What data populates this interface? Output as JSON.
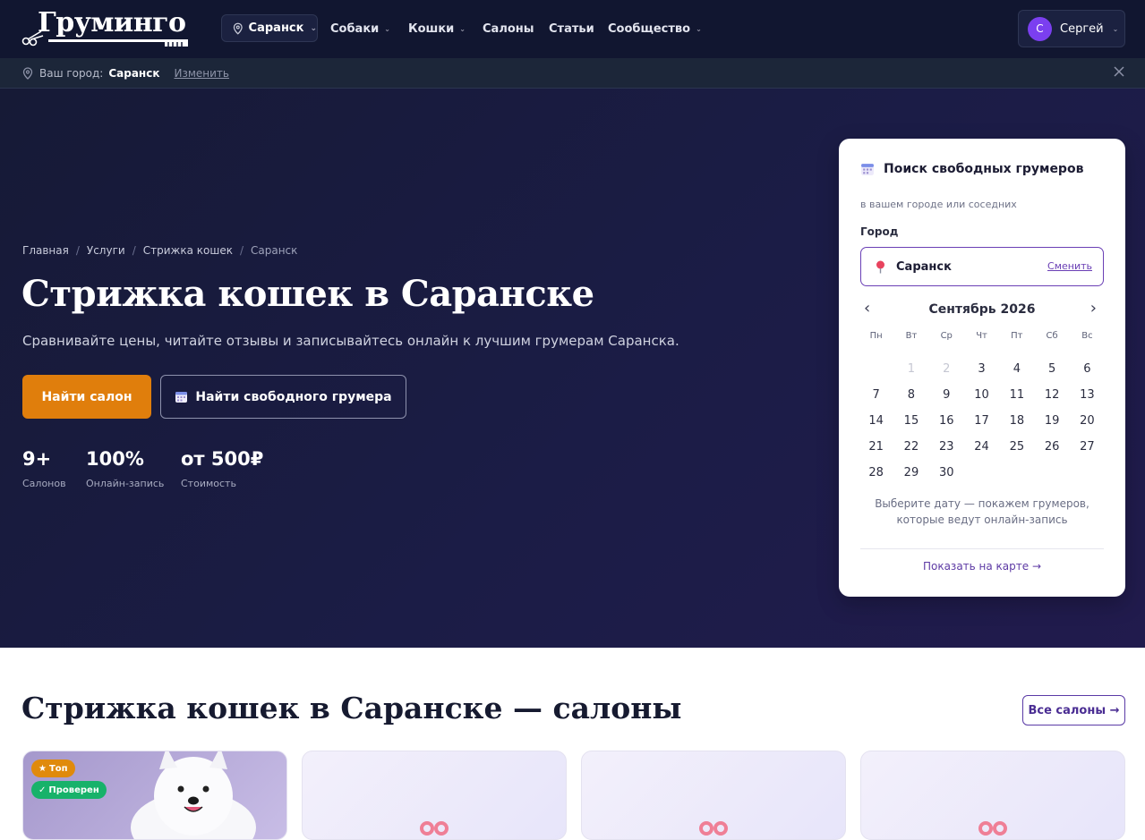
{
  "header": {
    "logo_text": "Грумингo",
    "city": "Саранск",
    "nav": [
      "Собаки",
      "Кошки",
      "Салоны",
      "Статьи",
      "Сообщество"
    ],
    "user": {
      "initial": "С",
      "name": "Сергей"
    }
  },
  "citybar": {
    "label": "Ваш город:",
    "city": "Саранск",
    "change": "Изменить"
  },
  "hero": {
    "breadcrumbs": [
      "Главная",
      "Услуги",
      "Стрижка кошек",
      "Саранск"
    ],
    "title": "Стрижка кошек в Саранске",
    "subtitle": "Сравнивайте цены, читайте отзывы и записывайтесь онлайн к лучшим грумерам Саранска.",
    "btn_find_salon": "Найти салон",
    "btn_find_groomer": "Найти свободного грумера",
    "stats": [
      {
        "value": "9+",
        "label": "Салонов"
      },
      {
        "value": "100%",
        "label": "Онлайн-запись"
      },
      {
        "value": "от 500₽",
        "label": "Стоимость"
      }
    ]
  },
  "panel": {
    "title": "Поиск свободных грумеров",
    "subtitle": "в вашем городе или соседних",
    "city_label": "Город",
    "city": "Саранск",
    "city_change": "Сменить",
    "month": "Сентябрь 2026",
    "weekdays": [
      "Пн",
      "Вт",
      "Ср",
      "Чт",
      "Пт",
      "Сб",
      "Вс"
    ],
    "leading_blanks": 1,
    "past_days": [
      1,
      2
    ],
    "days_in_month": 30,
    "hint": "Выберите дату — покажем грумеров, которые ведут онлайн-запись",
    "map_link": "Показать на карте →"
  },
  "salons": {
    "title": "Стрижка кошек в Саранске — салоны",
    "all_button": "Все салоны →",
    "badges": {
      "top": "Топ",
      "verified": "Проверен"
    }
  },
  "colors": {
    "header_bg": "#111630",
    "accent_orange": "#e07e0c",
    "accent_purple": "#6a3fb5",
    "verified_green": "#17b26a"
  }
}
